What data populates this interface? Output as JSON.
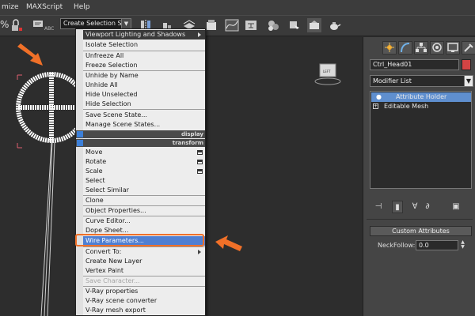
{
  "menubar": {
    "items": [
      {
        "label": "mize"
      },
      {
        "label": "MAXScript"
      },
      {
        "label": "Help"
      }
    ]
  },
  "toolbar": {
    "selection_set": "Create Selection Se",
    "percent_glyph": "%",
    "abc_label": "ABC"
  },
  "viewport": {
    "view_cube_label": "LEFT"
  },
  "quad_menu": {
    "items": [
      {
        "label": "Viewport Lighting and Shadows",
        "style": "dark",
        "arrow": true
      },
      {
        "label": "Isolate Selection"
      },
      {
        "label": "Unfreeze All"
      },
      {
        "label": "Freeze Selection"
      },
      {
        "label": "Unhide by Name"
      },
      {
        "label": "Unhide All"
      },
      {
        "label": "Hide Unselected"
      },
      {
        "label": "Hide Selection"
      },
      {
        "label": "Save Scene State..."
      },
      {
        "label": "Manage Scene States..."
      },
      {
        "label": "Move",
        "box": true
      },
      {
        "label": "Rotate",
        "box": true
      },
      {
        "label": "Scale",
        "box": true
      },
      {
        "label": "Select"
      },
      {
        "label": "Select Similar"
      },
      {
        "label": "Clone"
      },
      {
        "label": "Object Properties..."
      },
      {
        "label": "Curve Editor..."
      },
      {
        "label": "Dope Sheet..."
      },
      {
        "label": "Wire Parameters...",
        "highlight": true
      },
      {
        "label": "Convert To:",
        "arrow": true
      },
      {
        "label": "Create New Layer"
      },
      {
        "label": "Vertex Paint"
      },
      {
        "label": "Save Character...",
        "disabled": true
      },
      {
        "label": "V-Ray properties"
      },
      {
        "label": "V-Ray scene converter"
      },
      {
        "label": "V-Ray mesh export"
      }
    ],
    "bands": [
      {
        "label": "display"
      },
      {
        "label": "transform"
      }
    ]
  },
  "command_panel": {
    "object_name": "Ctrl_Head01",
    "object_color": "#d44444",
    "modifier_list": "Modifier List",
    "stack": [
      {
        "label": "Attribute Holder",
        "selected": true
      },
      {
        "label": "Editable Mesh"
      }
    ],
    "rollout_title": "Custom Attributes",
    "neck_follow_label": "NeckFollow:",
    "neck_follow_value": "0.0"
  },
  "colors": {
    "highlight": "#4f7fd2",
    "annotation_arrow": "#f07028"
  }
}
